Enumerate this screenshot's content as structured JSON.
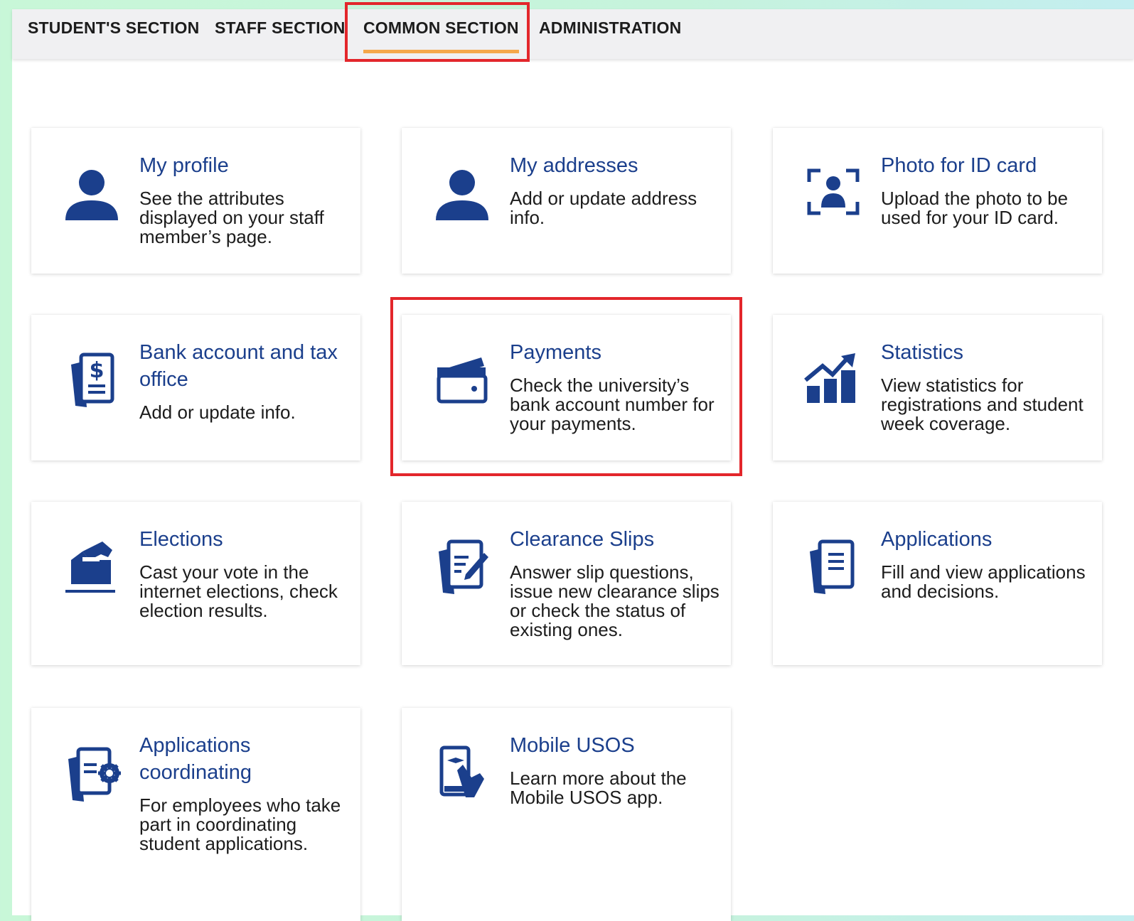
{
  "tabs": [
    {
      "label": "STUDENT'S SECTION"
    },
    {
      "label": "STAFF SECTION"
    },
    {
      "label": "COMMON SECTION",
      "active": true
    },
    {
      "label": "ADMINISTRATION"
    }
  ],
  "colors": {
    "title": "#1b3f8c",
    "icon": "#1b3f8c",
    "active_tab_underline": "#f5a84b",
    "highlight": "#e3262b"
  },
  "cards": [
    {
      "icon": "user-icon",
      "title": "My profile",
      "description": "See the attributes displayed on your staff member’s page."
    },
    {
      "icon": "user-icon",
      "title": "My addresses",
      "description": "Add or update address info."
    },
    {
      "icon": "id-photo-icon",
      "title": "Photo for ID card",
      "description": "Upload the photo to be used for your ID card."
    },
    {
      "icon": "bank-document-icon",
      "title": "Bank account and tax office",
      "description": "Add or update info."
    },
    {
      "icon": "wallet-icon",
      "title": "Payments",
      "description": "Check the university’s bank account number for your payments."
    },
    {
      "icon": "statistics-icon",
      "title": "Statistics",
      "description": "View statistics for registrations and student week coverage."
    },
    {
      "icon": "ballot-box-icon",
      "title": "Elections",
      "description": "Cast your vote in the internet elections, check election results."
    },
    {
      "icon": "clearance-slip-icon",
      "title": "Clearance Slips",
      "description": "Answer slip questions, issue new clearance slips or check the status of existing ones."
    },
    {
      "icon": "document-icon",
      "title": "Applications",
      "description": "Fill and view applications and decisions."
    },
    {
      "icon": "document-gear-icon",
      "title": "Applications coordinating",
      "description": "For employees who take part in coordinating student applications."
    },
    {
      "icon": "mobile-phone-icon",
      "title": "Mobile USOS",
      "description": "Learn more about the Mobile USOS app."
    }
  ]
}
